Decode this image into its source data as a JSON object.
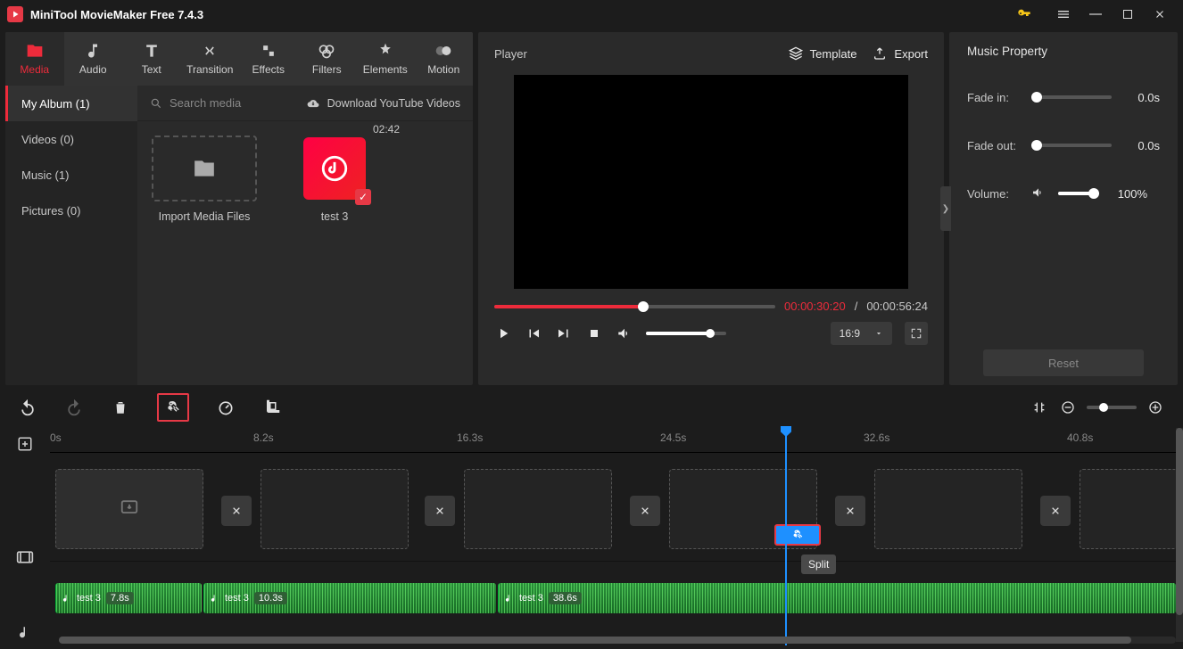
{
  "app": {
    "title": "MiniTool MovieMaker Free 7.4.3"
  },
  "tabs": {
    "media": "Media",
    "audio": "Audio",
    "text": "Text",
    "transition": "Transition",
    "effects": "Effects",
    "filters": "Filters",
    "elements": "Elements",
    "motion": "Motion"
  },
  "media_sidebar": {
    "my_album": "My Album (1)",
    "videos": "Videos (0)",
    "music": "Music (1)",
    "pictures": "Pictures (0)"
  },
  "search": {
    "placeholder": "Search media",
    "download": "Download YouTube Videos"
  },
  "thumbs": {
    "import": "Import Media Files",
    "clip_name": "test 3",
    "clip_dur": "02:42"
  },
  "player": {
    "label": "Player",
    "template": "Template",
    "export": "Export",
    "time_current": "00:00:30:20",
    "time_total": "00:00:56:24",
    "aspect": "16:9"
  },
  "props": {
    "title": "Music Property",
    "fade_in": "Fade in:",
    "fade_out": "Fade out:",
    "volume": "Volume:",
    "fade_in_val": "0.0s",
    "fade_out_val": "0.0s",
    "volume_val": "100%",
    "reset": "Reset"
  },
  "ruler": {
    "t0": "0s",
    "t1": "8.2s",
    "t2": "16.3s",
    "t3": "24.5s",
    "t4": "32.6s",
    "t5": "40.8s"
  },
  "clips": {
    "a1_name": "test 3",
    "a1_dur": "7.8s",
    "a2_name": "test 3",
    "a2_dur": "10.3s",
    "a3_name": "test 3",
    "a3_dur": "38.6s"
  },
  "tooltip": {
    "split": "Split"
  }
}
